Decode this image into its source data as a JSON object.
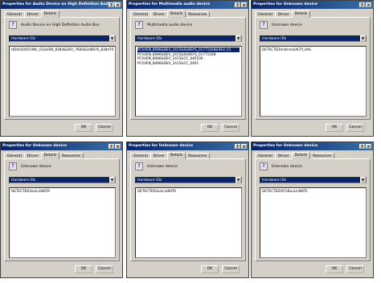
{
  "dialogs": [
    {
      "title": "Properties for Audio Device on High Definition Audio Bus",
      "tabs": [
        "General",
        "Driver",
        "Details"
      ],
      "device_name": "Audio Device on High Definition Audio Bus",
      "property": "Hardware IDs",
      "values": [
        "HDAUDIO\\FUNC_01&VEN_8384&DEV_7680&SUBSYS_83847680"
      ],
      "selected_index": -1,
      "ok": "OK",
      "cancel": "Cancel"
    },
    {
      "title": "Properties for Multimedia audio device",
      "tabs": [
        "General",
        "Driver",
        "Details",
        "Resources"
      ],
      "device_name": "Multimedia audio device",
      "property": "Hardware IDs",
      "values": [
        "PCI\\VEN_8086&DEV_2415&SUBSYS_01771028&REV_01",
        "PCI\\VEN_8086&DEV_2415&SUBSYS_01771028",
        "PCI\\VEN_8086&DEV_2415&CC_040100",
        "PCI\\VEN_8086&DEV_2415&CC_0401"
      ],
      "selected_index": 0,
      "ok": "OK",
      "cancel": "Cancel"
    },
    {
      "title": "Properties for Unknown device",
      "tabs": [
        "General",
        "Driver",
        "Details"
      ],
      "device_name": "Unknown device",
      "property": "Hardware IDs",
      "values": [
        "DETECTED\\Internal\\ACPI_HAL"
      ],
      "selected_index": -1,
      "ok": "OK",
      "cancel": "Cancel"
    },
    {
      "title": "Properties for Unknown device",
      "tabs": [
        "General",
        "Driver",
        "Details",
        "Resources"
      ],
      "device_name": "Unknown device",
      "property": "Hardware IDs",
      "values": [
        "DETECTED\\Isa\\LinNATA"
      ],
      "selected_index": -1,
      "ok": "OK",
      "cancel": "Cancel"
    },
    {
      "title": "Properties for Unknown device",
      "tabs": [
        "General",
        "Driver",
        "Details",
        "Resources"
      ],
      "device_name": "Unknown device",
      "property": "Hardware IDs",
      "values": [
        "DETECTED\\Isa\\LinNATA"
      ],
      "selected_index": -1,
      "ok": "OK",
      "cancel": "Cancel"
    },
    {
      "title": "Properties for Unknown device",
      "tabs": [
        "General",
        "Driver",
        "Details",
        "Resources"
      ],
      "device_name": "Unknown device",
      "property": "Hardware IDs",
      "values": [
        "DETECTED\\PCI\\BusLinNATA"
      ],
      "selected_index": -1,
      "ok": "OK",
      "cancel": "Cancel"
    }
  ]
}
